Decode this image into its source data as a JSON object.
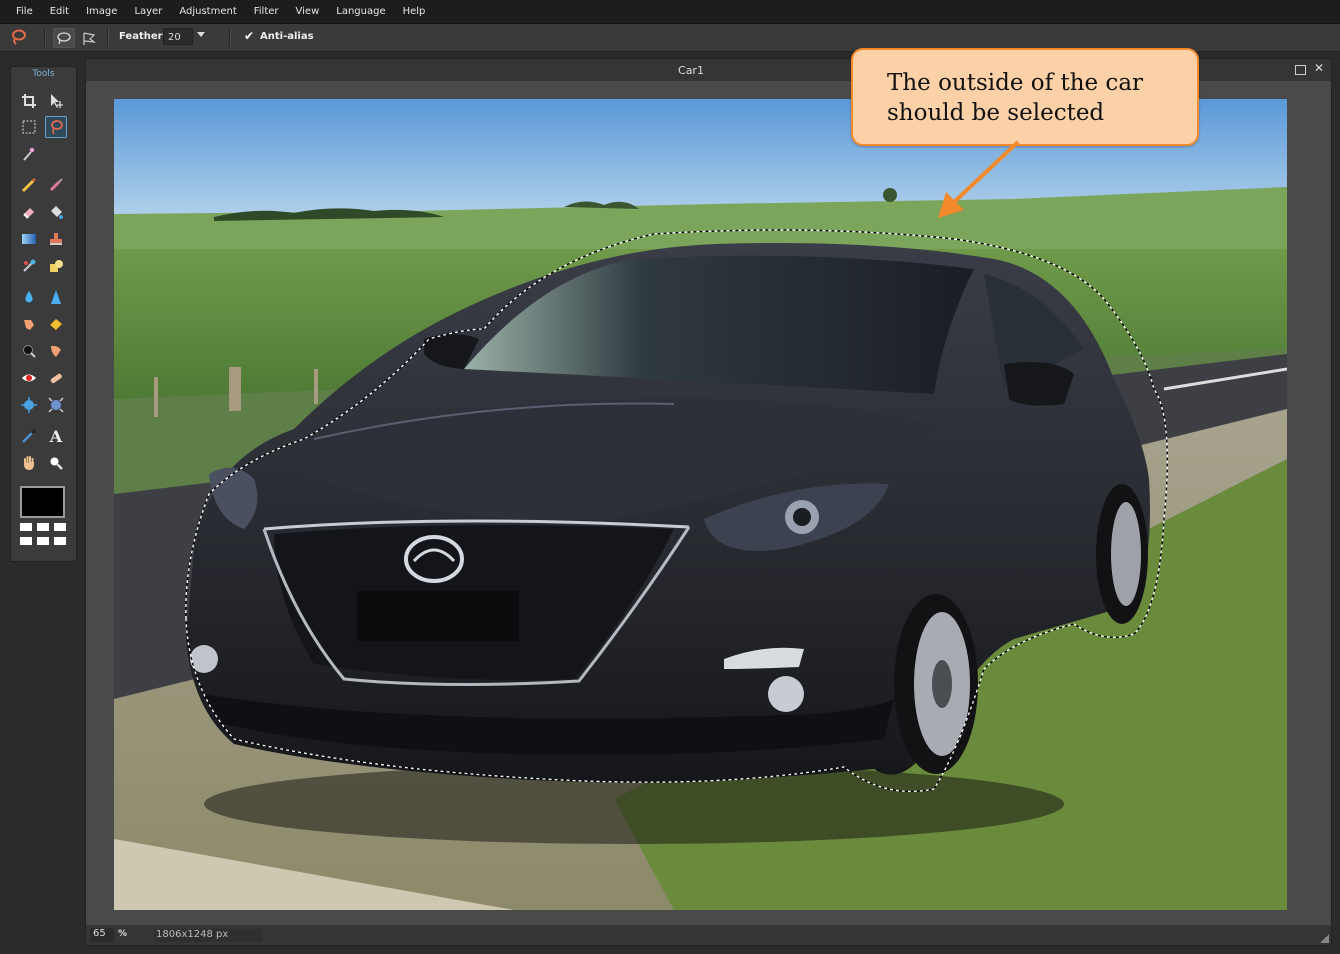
{
  "menu": [
    "File",
    "Edit",
    "Image",
    "Layer",
    "Adjustment",
    "Filter",
    "View",
    "Language",
    "Help"
  ],
  "options": {
    "feather_label": "Feather:",
    "feather_value": "20",
    "antialias_label": "Anti-alias",
    "antialias_checked": true
  },
  "tools": {
    "title": "Tools",
    "items": [
      "crop-tool",
      "move-tool",
      "marquee-tool",
      "lasso-tool",
      "magic-wand-tool",
      "pencil-tool",
      "brush-tool",
      "eraser-tool",
      "paint-bucket-tool",
      "gradient-tool",
      "clone-stamp-tool",
      "color-replace-tool",
      "drawing-tool",
      "blur-tool",
      "sharpen-tool",
      "smudge-tool",
      "sponge-tool",
      "dodge-tool",
      "burn-tool",
      "red-eye-tool",
      "spot-heal-tool",
      "bloat-tool",
      "pinch-tool",
      "color-picker-tool",
      "type-tool",
      "hand-tool",
      "zoom-tool"
    ],
    "active": "lasso-tool",
    "foreground_color": "#000000"
  },
  "document": {
    "title": "Car1",
    "zoom": "65",
    "zoom_unit": "%",
    "dimensions": "1806x1248 px"
  },
  "callout": {
    "line1": "The outside of the car",
    "line2": "should be selected"
  },
  "colors": {
    "accent": "#68a2c4",
    "callout_fill": "#fcd1a7",
    "callout_border": "#f28a2c"
  }
}
